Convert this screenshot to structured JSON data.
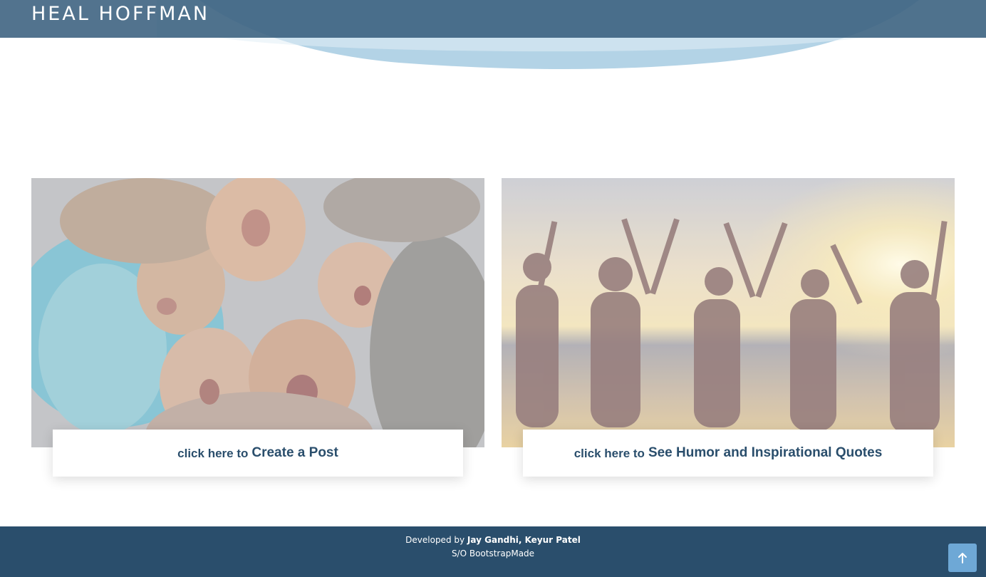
{
  "header": {
    "brand": "HEAL HOFFMAN"
  },
  "cards": [
    {
      "image": "group-of-friends-huddle-photo",
      "caption_prefix": "click here to",
      "caption_main": "Create a Post"
    },
    {
      "image": "friends-on-beach-at-sunset-photo",
      "caption_prefix": "click here to",
      "caption_main": "See Humor and Inspirational Quotes"
    }
  ],
  "footer": {
    "developed_by": "Developed by",
    "developers": "Jay Gandhi, Keyur Patel",
    "credit": "S/O BootstrapMade"
  },
  "back_to_top": {
    "icon": "arrow-up-icon"
  },
  "colors": {
    "header": "#2c5475",
    "wave": "#b3d3e6",
    "caption_text": "#2a4e6c",
    "footer": "#2a4e6c",
    "back_to_top": "#6ea8d6"
  }
}
